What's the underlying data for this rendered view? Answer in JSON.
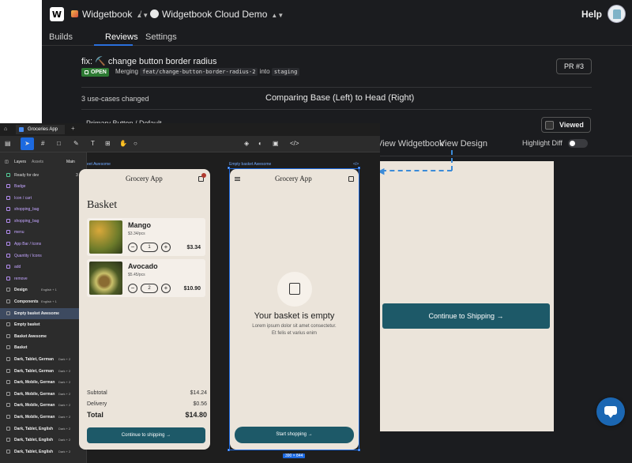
{
  "widgetbook": {
    "logo": "W",
    "org": "Widgetbook",
    "separator": "/",
    "repo": "Widgetbook Cloud Demo",
    "help": "Help",
    "tabs": [
      "Builds",
      "Reviews",
      "Settings"
    ],
    "pr": {
      "title": "fix: ⛏️ change button border radius",
      "status": "OPEN",
      "merging": "Merging",
      "source": "feat/change-button-border-radius-2",
      "into": "into",
      "target": "staging",
      "number": "PR #3"
    },
    "usecases": "3 use-cases changed",
    "comparing": "Comparing Base (Left) to Head (Right)",
    "row_title": "Primary Button / Default",
    "viewed": "Viewed",
    "subtabs": [
      "View Widgetbook",
      "View Design"
    ],
    "highlight_diff": "Highlight Diff",
    "preview_button": "Continue to Shipping"
  },
  "figma": {
    "file_tab": "Groceries App",
    "layers_tab": "Layers",
    "assets_tab": "Assets",
    "page": "Main",
    "ready": "Ready for dev",
    "ready_count": "3",
    "layers": [
      {
        "name": "Badge",
        "style": "p",
        "tag": ""
      },
      {
        "name": "Icon / cart",
        "style": "p",
        "tag": ""
      },
      {
        "name": "shopping_bag",
        "style": "p",
        "tag": ""
      },
      {
        "name": "shopping_bag",
        "style": "p",
        "tag": ""
      },
      {
        "name": "menu",
        "style": "p",
        "tag": ""
      },
      {
        "name": "App Bar / Icons",
        "style": "p",
        "tag": ""
      },
      {
        "name": "Quantity / Icons",
        "style": "p",
        "tag": ""
      },
      {
        "name": "add",
        "style": "p",
        "tag": ""
      },
      {
        "name": "remove",
        "style": "p",
        "tag": ""
      },
      {
        "name": "Design",
        "style": "b",
        "tag": "English + 1"
      },
      {
        "name": "Components",
        "style": "b",
        "tag": "English + 1"
      },
      {
        "name": "Empty basket Awesome",
        "style": "b",
        "tag": ""
      },
      {
        "name": "Empty basket",
        "style": "b",
        "tag": ""
      },
      {
        "name": "Basket Awesome",
        "style": "b",
        "tag": ""
      },
      {
        "name": "Basket",
        "style": "b",
        "tag": ""
      },
      {
        "name": "Dark, Tablet, German",
        "style": "b",
        "tag": "Dark + 2"
      },
      {
        "name": "Dark, Tablet, German",
        "style": "b",
        "tag": "Dark + 2"
      },
      {
        "name": "Dark, Mobile, German",
        "style": "b",
        "tag": "Dark + 2"
      },
      {
        "name": "Dark, Mobile, German",
        "style": "b",
        "tag": "Dark + 2"
      },
      {
        "name": "Dark, Mobile, German",
        "style": "b",
        "tag": "Dark + 2"
      },
      {
        "name": "Dark, Mobile, German",
        "style": "b",
        "tag": "Dark + 2"
      },
      {
        "name": "Dark, Tablet, English",
        "style": "b",
        "tag": "Dark + 2"
      },
      {
        "name": "Dark, Tablet, English",
        "style": "b",
        "tag": "Dark + 2"
      },
      {
        "name": "Dark, Tablet, English",
        "style": "b",
        "tag": "Dark + 2"
      }
    ],
    "frame_left_label": "eet Awesome",
    "frame_right_label": "Empty basket Awesome",
    "code_icon": "</>",
    "dimensions": "390 × 844",
    "basket": {
      "app_title": "Grocery App",
      "heading": "Basket",
      "items": [
        {
          "name": "Mango",
          "price": "$3.34/pcs",
          "qty": "1",
          "total": "$3.34"
        },
        {
          "name": "Avocado",
          "price": "$5.45/pcs",
          "qty": "2",
          "total": "$10.90"
        }
      ],
      "subtotal_label": "Subtotal",
      "subtotal": "$14.24",
      "delivery_label": "Delivery",
      "delivery": "$0.56",
      "total_label": "Total",
      "total": "$14.80",
      "cta": "Continue to shipping"
    },
    "empty": {
      "app_title": "Grocery App",
      "title": "Your basket is empty",
      "body1": "Lorem ipsum dolor sit amet consectetur.",
      "body2": "Et felis et varius enim",
      "cta": "Start shopping"
    }
  }
}
